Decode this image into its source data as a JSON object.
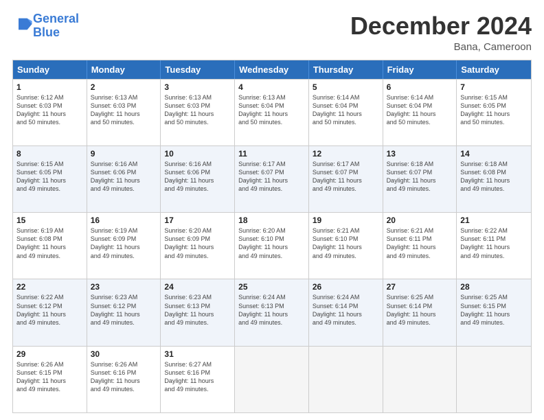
{
  "header": {
    "logo_text_general": "General",
    "logo_text_blue": "Blue",
    "month_title": "December 2024",
    "location": "Bana, Cameroon"
  },
  "days_of_week": [
    "Sunday",
    "Monday",
    "Tuesday",
    "Wednesday",
    "Thursday",
    "Friday",
    "Saturday"
  ],
  "weeks": [
    [
      {
        "day": "1",
        "lines": [
          "Sunrise: 6:12 AM",
          "Sunset: 6:03 PM",
          "Daylight: 11 hours",
          "and 50 minutes."
        ]
      },
      {
        "day": "2",
        "lines": [
          "Sunrise: 6:13 AM",
          "Sunset: 6:03 PM",
          "Daylight: 11 hours",
          "and 50 minutes."
        ]
      },
      {
        "day": "3",
        "lines": [
          "Sunrise: 6:13 AM",
          "Sunset: 6:03 PM",
          "Daylight: 11 hours",
          "and 50 minutes."
        ]
      },
      {
        "day": "4",
        "lines": [
          "Sunrise: 6:13 AM",
          "Sunset: 6:04 PM",
          "Daylight: 11 hours",
          "and 50 minutes."
        ]
      },
      {
        "day": "5",
        "lines": [
          "Sunrise: 6:14 AM",
          "Sunset: 6:04 PM",
          "Daylight: 11 hours",
          "and 50 minutes."
        ]
      },
      {
        "day": "6",
        "lines": [
          "Sunrise: 6:14 AM",
          "Sunset: 6:04 PM",
          "Daylight: 11 hours",
          "and 50 minutes."
        ]
      },
      {
        "day": "7",
        "lines": [
          "Sunrise: 6:15 AM",
          "Sunset: 6:05 PM",
          "Daylight: 11 hours",
          "and 50 minutes."
        ]
      }
    ],
    [
      {
        "day": "8",
        "lines": [
          "Sunrise: 6:15 AM",
          "Sunset: 6:05 PM",
          "Daylight: 11 hours",
          "and 49 minutes."
        ]
      },
      {
        "day": "9",
        "lines": [
          "Sunrise: 6:16 AM",
          "Sunset: 6:06 PM",
          "Daylight: 11 hours",
          "and 49 minutes."
        ]
      },
      {
        "day": "10",
        "lines": [
          "Sunrise: 6:16 AM",
          "Sunset: 6:06 PM",
          "Daylight: 11 hours",
          "and 49 minutes."
        ]
      },
      {
        "day": "11",
        "lines": [
          "Sunrise: 6:17 AM",
          "Sunset: 6:07 PM",
          "Daylight: 11 hours",
          "and 49 minutes."
        ]
      },
      {
        "day": "12",
        "lines": [
          "Sunrise: 6:17 AM",
          "Sunset: 6:07 PM",
          "Daylight: 11 hours",
          "and 49 minutes."
        ]
      },
      {
        "day": "13",
        "lines": [
          "Sunrise: 6:18 AM",
          "Sunset: 6:07 PM",
          "Daylight: 11 hours",
          "and 49 minutes."
        ]
      },
      {
        "day": "14",
        "lines": [
          "Sunrise: 6:18 AM",
          "Sunset: 6:08 PM",
          "Daylight: 11 hours",
          "and 49 minutes."
        ]
      }
    ],
    [
      {
        "day": "15",
        "lines": [
          "Sunrise: 6:19 AM",
          "Sunset: 6:08 PM",
          "Daylight: 11 hours",
          "and 49 minutes."
        ]
      },
      {
        "day": "16",
        "lines": [
          "Sunrise: 6:19 AM",
          "Sunset: 6:09 PM",
          "Daylight: 11 hours",
          "and 49 minutes."
        ]
      },
      {
        "day": "17",
        "lines": [
          "Sunrise: 6:20 AM",
          "Sunset: 6:09 PM",
          "Daylight: 11 hours",
          "and 49 minutes."
        ]
      },
      {
        "day": "18",
        "lines": [
          "Sunrise: 6:20 AM",
          "Sunset: 6:10 PM",
          "Daylight: 11 hours",
          "and 49 minutes."
        ]
      },
      {
        "day": "19",
        "lines": [
          "Sunrise: 6:21 AM",
          "Sunset: 6:10 PM",
          "Daylight: 11 hours",
          "and 49 minutes."
        ]
      },
      {
        "day": "20",
        "lines": [
          "Sunrise: 6:21 AM",
          "Sunset: 6:11 PM",
          "Daylight: 11 hours",
          "and 49 minutes."
        ]
      },
      {
        "day": "21",
        "lines": [
          "Sunrise: 6:22 AM",
          "Sunset: 6:11 PM",
          "Daylight: 11 hours",
          "and 49 minutes."
        ]
      }
    ],
    [
      {
        "day": "22",
        "lines": [
          "Sunrise: 6:22 AM",
          "Sunset: 6:12 PM",
          "Daylight: 11 hours",
          "and 49 minutes."
        ]
      },
      {
        "day": "23",
        "lines": [
          "Sunrise: 6:23 AM",
          "Sunset: 6:12 PM",
          "Daylight: 11 hours",
          "and 49 minutes."
        ]
      },
      {
        "day": "24",
        "lines": [
          "Sunrise: 6:23 AM",
          "Sunset: 6:13 PM",
          "Daylight: 11 hours",
          "and 49 minutes."
        ]
      },
      {
        "day": "25",
        "lines": [
          "Sunrise: 6:24 AM",
          "Sunset: 6:13 PM",
          "Daylight: 11 hours",
          "and 49 minutes."
        ]
      },
      {
        "day": "26",
        "lines": [
          "Sunrise: 6:24 AM",
          "Sunset: 6:14 PM",
          "Daylight: 11 hours",
          "and 49 minutes."
        ]
      },
      {
        "day": "27",
        "lines": [
          "Sunrise: 6:25 AM",
          "Sunset: 6:14 PM",
          "Daylight: 11 hours",
          "and 49 minutes."
        ]
      },
      {
        "day": "28",
        "lines": [
          "Sunrise: 6:25 AM",
          "Sunset: 6:15 PM",
          "Daylight: 11 hours",
          "and 49 minutes."
        ]
      }
    ],
    [
      {
        "day": "29",
        "lines": [
          "Sunrise: 6:26 AM",
          "Sunset: 6:15 PM",
          "Daylight: 11 hours",
          "and 49 minutes."
        ]
      },
      {
        "day": "30",
        "lines": [
          "Sunrise: 6:26 AM",
          "Sunset: 6:16 PM",
          "Daylight: 11 hours",
          "and 49 minutes."
        ]
      },
      {
        "day": "31",
        "lines": [
          "Sunrise: 6:27 AM",
          "Sunset: 6:16 PM",
          "Daylight: 11 hours",
          "and 49 minutes."
        ]
      },
      {
        "day": "",
        "lines": []
      },
      {
        "day": "",
        "lines": []
      },
      {
        "day": "",
        "lines": []
      },
      {
        "day": "",
        "lines": []
      }
    ]
  ]
}
